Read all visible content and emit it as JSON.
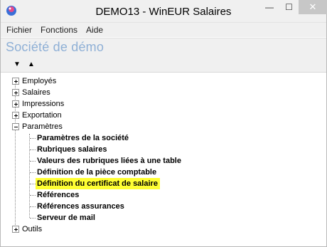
{
  "window": {
    "title": "DEMO13 - WinEUR Salaires",
    "minimize_glyph": "—",
    "maximize_glyph": "☐",
    "close_glyph": "✕",
    "close_hover_color": "#c7c7c7"
  },
  "menu": {
    "items": [
      "Fichier",
      "Fonctions",
      "Aide"
    ]
  },
  "company": {
    "name": "Société de démo",
    "color": "#8fb0d6"
  },
  "toolbar": {
    "down_glyph": "▼",
    "up_glyph": "▲"
  },
  "tree": {
    "nodes": [
      {
        "label": "Employés",
        "state": "collapsed"
      },
      {
        "label": "Salaires",
        "state": "collapsed"
      },
      {
        "label": "Impressions",
        "state": "collapsed"
      },
      {
        "label": "Exportation",
        "state": "collapsed"
      },
      {
        "label": "Paramètres",
        "state": "expanded"
      },
      {
        "label": "Outils",
        "state": "collapsed"
      }
    ],
    "parametres_children": [
      "Paramètres de la société",
      "Rubriques salaires",
      "Valeurs des rubriques liées à une table",
      "Définition de la pièce comptable",
      "Définition du certificat de salaire",
      "Références",
      "Références assurances",
      "Serveur de mail"
    ],
    "selected_child": "Définition du certificat de salaire",
    "highlight_color": "#ffff33"
  }
}
